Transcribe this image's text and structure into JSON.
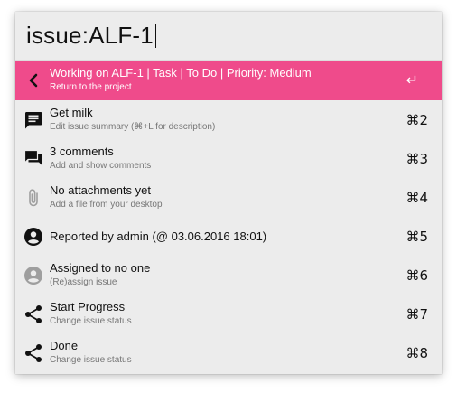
{
  "search": {
    "query": "issue:ALF-1"
  },
  "items": [
    {
      "title": "Working on ALF-1 | Task | To Do | Priority: Medium",
      "subtitle": "Return to the project",
      "shortcut": "↵",
      "icon": "chevron-left-icon"
    },
    {
      "title": "Get milk",
      "subtitle": "Edit issue summary (⌘+L for description)",
      "shortcut": "⌘2",
      "icon": "summary-message-icon"
    },
    {
      "title": "3 comments",
      "subtitle": "Add and show comments",
      "shortcut": "⌘3",
      "icon": "comments-icon"
    },
    {
      "title": "No attachments yet",
      "subtitle": "Add a file from your desktop",
      "shortcut": "⌘4",
      "icon": "paperclip-icon"
    },
    {
      "title": "Reported by admin (@ 03.06.2016 18:01)",
      "subtitle": "",
      "shortcut": "⌘5",
      "icon": "reporter-avatar-icon"
    },
    {
      "title": "Assigned to no one",
      "subtitle": "(Re)assign issue",
      "shortcut": "⌘6",
      "icon": "assignee-avatar-icon"
    },
    {
      "title": "Start Progress",
      "subtitle": "Change issue status",
      "shortcut": "⌘7",
      "icon": "share-transition-icon"
    },
    {
      "title": "Done",
      "subtitle": "Change issue status",
      "shortcut": "⌘8",
      "icon": "share-transition-icon"
    }
  ],
  "colors": {
    "highlight": "#ef4b8b",
    "panel": "#ececec",
    "icon_dark": "#111111",
    "icon_muted": "#9e9e9e"
  }
}
